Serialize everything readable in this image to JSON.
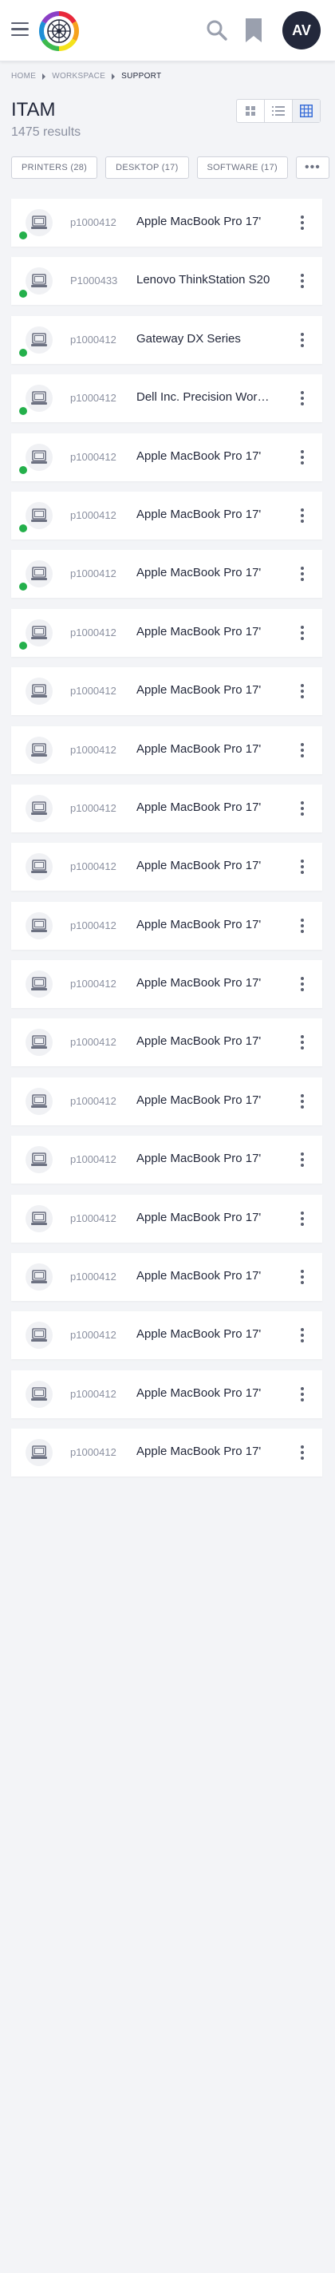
{
  "header": {
    "avatar_initials": "AV",
    "logo_icon": "multicolor-ring-logo",
    "search_icon": "search-icon",
    "bookmark_icon": "bookmark-icon"
  },
  "breadcrumb": [
    "Home",
    "Workspace",
    "Support"
  ],
  "page": {
    "title": "ITAM",
    "results": "1475 results"
  },
  "view_modes": [
    {
      "name": "view-grid-small-icon",
      "active": false
    },
    {
      "name": "view-list-icon",
      "active": false
    },
    {
      "name": "view-table-icon",
      "active": true
    }
  ],
  "filters": [
    {
      "label": "PRINTERS (28)"
    },
    {
      "label": "DESKTOP (17)"
    },
    {
      "label": "SOFTWARE (17)"
    }
  ],
  "more_filters_label": "•••",
  "colors": {
    "status_online": "#24b04b",
    "text_primary": "#23283b",
    "text_muted": "#8b90a0"
  },
  "assets": [
    {
      "id": "p1000412",
      "name": "Apple MacBook Pro 17'",
      "online": true
    },
    {
      "id": "P1000433",
      "name": "Lenovo ThinkStation S20",
      "online": true
    },
    {
      "id": "p1000412",
      "name": "Gateway DX Series",
      "online": true
    },
    {
      "id": "p1000412",
      "name": "Dell Inc. Precision WorkStation",
      "online": true
    },
    {
      "id": "p1000412",
      "name": "Apple MacBook Pro 17'",
      "online": true
    },
    {
      "id": "p1000412",
      "name": "Apple MacBook Pro 17'",
      "online": true
    },
    {
      "id": "p1000412",
      "name": "Apple MacBook Pro 17'",
      "online": true
    },
    {
      "id": "p1000412",
      "name": "Apple MacBook Pro 17'",
      "online": true
    },
    {
      "id": "p1000412",
      "name": "Apple MacBook Pro 17'",
      "online": false
    },
    {
      "id": "p1000412",
      "name": "Apple MacBook Pro 17'",
      "online": false
    },
    {
      "id": "p1000412",
      "name": "Apple MacBook Pro 17'",
      "online": false
    },
    {
      "id": "p1000412",
      "name": "Apple MacBook Pro 17'",
      "online": false
    },
    {
      "id": "p1000412",
      "name": "Apple MacBook Pro 17'",
      "online": false
    },
    {
      "id": "p1000412",
      "name": "Apple MacBook Pro 17'",
      "online": false
    },
    {
      "id": "p1000412",
      "name": "Apple MacBook Pro 17'",
      "online": false
    },
    {
      "id": "p1000412",
      "name": "Apple MacBook Pro 17'",
      "online": false
    },
    {
      "id": "p1000412",
      "name": "Apple MacBook Pro 17'",
      "online": false
    },
    {
      "id": "p1000412",
      "name": "Apple MacBook Pro 17'",
      "online": false
    },
    {
      "id": "p1000412",
      "name": "Apple MacBook Pro 17'",
      "online": false
    },
    {
      "id": "p1000412",
      "name": "Apple MacBook Pro 17'",
      "online": false
    },
    {
      "id": "p1000412",
      "name": "Apple MacBook Pro 17'",
      "online": false
    },
    {
      "id": "p1000412",
      "name": "Apple MacBook Pro 17'",
      "online": false
    }
  ]
}
